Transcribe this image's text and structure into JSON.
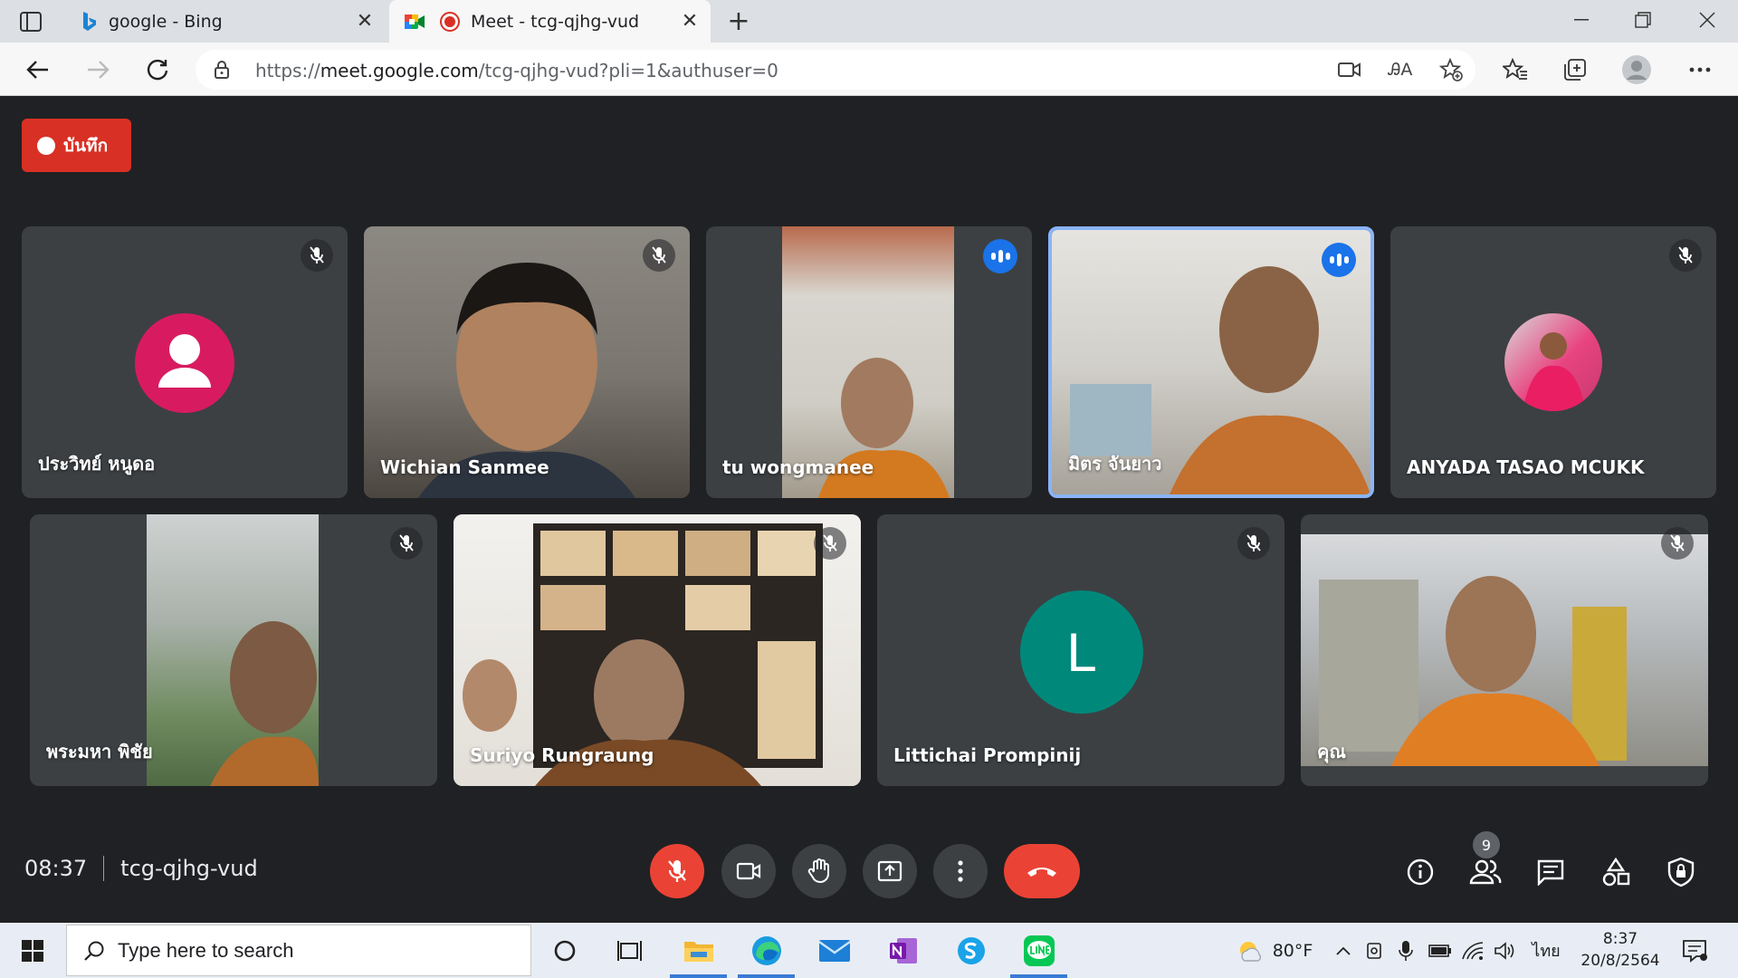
{
  "browser": {
    "tabs": [
      {
        "title": "google - Bing",
        "icon": "bing-icon",
        "active": false
      },
      {
        "title": "Meet - tcg-qjhg-vud",
        "icon": "meet-icon",
        "active": true
      }
    ],
    "address": {
      "url_prefix": "https://",
      "url_host": "meet.google.com",
      "url_path": "/tcg-qjhg-vud?pli=1&authuser=0"
    }
  },
  "meet": {
    "record_label": "บันทึก",
    "participants": [
      {
        "name": "ประวิทย์ หนูดอ",
        "status": "muted",
        "avatar": "generic-person",
        "avatar_color": "#d81b60"
      },
      {
        "name": "Wichian Sanmee",
        "status": "muted",
        "avatar": "video"
      },
      {
        "name": "tu wongmanee",
        "status": "speaking",
        "avatar": "video"
      },
      {
        "name": "มิตร จันยาว",
        "status": "speaking",
        "avatar": "video",
        "active": true
      },
      {
        "name": "ANYADA TASAO MCUKK",
        "status": "muted",
        "avatar": "photo"
      },
      {
        "name": "พระมหา พิชัย",
        "status": "muted",
        "avatar": "video"
      },
      {
        "name": "Suriyo Rungraung",
        "status": "muted",
        "avatar": "video"
      },
      {
        "name": "Littichai Prompinij",
        "status": "muted",
        "avatar": "letter",
        "letter": "L",
        "avatar_color": "#00897b"
      },
      {
        "name": "คุณ",
        "status": "muted",
        "avatar": "video"
      }
    ],
    "meeting_time": "08:37",
    "meeting_code": "tcg-qjhg-vud",
    "participant_count": "9"
  },
  "taskbar": {
    "search_placeholder": "Type here to search",
    "weather": "80°F",
    "language": "ไทย",
    "time": "8:37",
    "date": "20/8/2564"
  },
  "colors": {
    "meet_bg": "#202124",
    "tile_bg": "#3c4043",
    "accent_red": "#ea4335",
    "active_border": "#8ab4f8",
    "speaking": "#1a73e8"
  }
}
